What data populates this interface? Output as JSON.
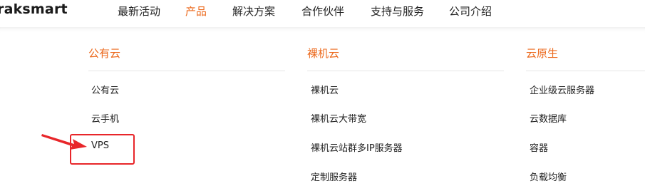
{
  "brand": {
    "logo_text": "raksmart"
  },
  "nav": {
    "items": [
      {
        "label": "最新活动",
        "active": false
      },
      {
        "label": "产品",
        "active": true
      },
      {
        "label": "解决方案",
        "active": false
      },
      {
        "label": "合作伙伴",
        "active": false
      },
      {
        "label": "支持与服务",
        "active": false
      },
      {
        "label": "公司介绍",
        "active": false
      }
    ]
  },
  "menu": {
    "columns": [
      {
        "title": "公有云",
        "items": [
          "公有云",
          "云手机",
          "VPS"
        ]
      },
      {
        "title": "裸机云",
        "items": [
          "裸机云",
          "裸机云大带宽",
          "裸机云站群多IP服务器",
          "定制服务器"
        ]
      },
      {
        "title": "云原生",
        "items": [
          "企业级云服务器",
          "云数据库",
          "容器",
          "负载均衡"
        ]
      }
    ]
  },
  "colors": {
    "accent": "#ec6a1e",
    "annotation": "#e8262a"
  }
}
